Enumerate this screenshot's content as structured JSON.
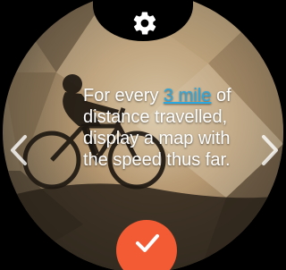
{
  "screen": {
    "message_before": "For every ",
    "distance_link": "3 mile",
    "message_after": " of distance travelled, display a map with the speed thus far."
  },
  "icons": {
    "settings": "gear-icon",
    "prev": "chevron-left-icon",
    "next": "chevron-right-icon",
    "confirm": "check-icon"
  },
  "colors": {
    "confirm_button": "#f35b35",
    "link": "#2aa8e0",
    "text": "#ffffff"
  }
}
